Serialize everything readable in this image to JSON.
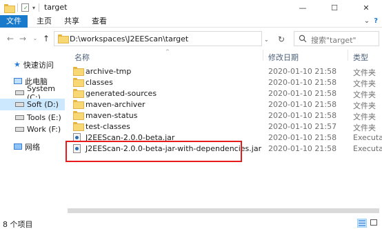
{
  "window": {
    "title": "target",
    "controls": {
      "minimize": "—",
      "maximize": "☐",
      "close": "✕"
    }
  },
  "ribbon": {
    "tabs": [
      "文件",
      "主页",
      "共享",
      "查看"
    ],
    "right": {
      "expand": "⌄",
      "help": "?"
    }
  },
  "nav": {
    "address": "D:\\workspaces\\J2EEScan\\target",
    "search_placeholder": "搜索\"target\""
  },
  "sidebar": {
    "items": [
      {
        "label": "快速访问",
        "icon": "star-icon"
      },
      {
        "label": "此电脑",
        "icon": "computer-icon"
      },
      {
        "label": "System (C:)",
        "icon": "drive-icon"
      },
      {
        "label": "Soft (D:)",
        "icon": "drive-icon"
      },
      {
        "label": "Tools (E:)",
        "icon": "drive-icon"
      },
      {
        "label": "Work (F:)",
        "icon": "drive-icon"
      },
      {
        "label": "网络",
        "icon": "network-icon"
      }
    ]
  },
  "columns": {
    "name": "名称",
    "modified": "修改日期",
    "type": "类型"
  },
  "files": [
    {
      "name": "archive-tmp",
      "date": "2020-01-10 21:58",
      "type": "文件夹",
      "kind": "folder"
    },
    {
      "name": "classes",
      "date": "2020-01-10 21:58",
      "type": "文件夹",
      "kind": "folder"
    },
    {
      "name": "generated-sources",
      "date": "2020-01-10 21:58",
      "type": "文件夹",
      "kind": "folder"
    },
    {
      "name": "maven-archiver",
      "date": "2020-01-10 21:58",
      "type": "文件夹",
      "kind": "folder"
    },
    {
      "name": "maven-status",
      "date": "2020-01-10 21:58",
      "type": "文件夹",
      "kind": "folder"
    },
    {
      "name": "test-classes",
      "date": "2020-01-10 21:57",
      "type": "文件夹",
      "kind": "folder"
    },
    {
      "name": "J2EEScan-2.0.0-beta.jar",
      "date": "2020-01-10 21:58",
      "type": "Executabl",
      "kind": "jar"
    },
    {
      "name": "J2EEScan-2.0.0-beta-jar-with-dependencies.jar",
      "date": "2020-01-10 21:58",
      "type": "Executabl",
      "kind": "jar"
    }
  ],
  "status": {
    "count": "8 个项目"
  },
  "colors": {
    "accent": "#1979ca",
    "selection": "#cce8ff",
    "highlight_border": "#e81b1b"
  }
}
